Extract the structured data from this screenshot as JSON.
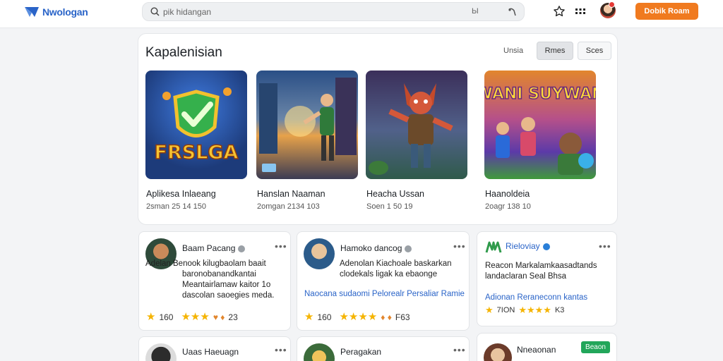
{
  "header": {
    "logo_text": "Nwologan",
    "search_placeholder": "pik hidangan",
    "search_badge": "Ы",
    "cta_label": "Dobik Roam",
    "notification_count": "4"
  },
  "featured": {
    "title": "Kapalenisian",
    "segment_label": "Unsia",
    "segment_a": "Rmes",
    "segment_b": "Sces",
    "games": [
      {
        "name": "Aplikesa Inlaeang",
        "meta": "2sman 25 14 150",
        "art_text": "FRSLGA",
        "colors": [
          "#1d3b7a",
          "#2d5fb5"
        ]
      },
      {
        "name": "Hanslan Naaman",
        "meta": "2omgan 2134 103",
        "art_text": "",
        "colors": [
          "#1c3f6e",
          "#e0913a"
        ]
      },
      {
        "name": "Heacha Ussan",
        "meta": "Soen 1 50 19",
        "art_text": "",
        "colors": [
          "#3b2f5a",
          "#a94b2c"
        ]
      },
      {
        "name": "Haanoldeia",
        "meta": "2oagr 138 10",
        "art_text": "WANI SUYWAN",
        "colors": [
          "#e2862d",
          "#5c3aa8"
        ]
      }
    ]
  },
  "posts": [
    {
      "author": "Baam Pacang",
      "body": "Adelan Benook kilugbaolam baait baronobanandkantai Meantairlamaw kaitor 1o dascolan saoegies meda.",
      "tags": "",
      "rating_count": "160",
      "rating_extra": "23",
      "avatar_colors": [
        "#c98a5a",
        "#2e4a3a"
      ]
    },
    {
      "author": "Hamoko dancog",
      "body": "Adenolan Kiachoale baskarkan clodekals ligak ka ebaonge",
      "tags": "Naocana sudaomi Pelorealr Persaliar Ramie",
      "rating_count": "160",
      "rating_extra": "F63",
      "avatar_colors": [
        "#e8c49b",
        "#2b5b8a"
      ]
    },
    {
      "author": "Rieloviay",
      "body": "Reacon Markalamkaasadtands landaclaran Seal Bhsa",
      "tags": "Adionan Reraneconn kantas",
      "rating_count": "7ION",
      "rating_extra": "K3",
      "avatar_colors": [
        "#2f9a4b",
        "#ffffff"
      ]
    },
    {
      "author": "Uaas Haeuagn",
      "avatar_colors": [
        "#2c2c2c",
        "#dcdcdc"
      ]
    },
    {
      "author": "Peragakan",
      "avatar_colors": [
        "#3b6b3a",
        "#f0c45b"
      ]
    },
    {
      "author": "Nneaonan",
      "follow_label": "Beaon",
      "avatar_colors": [
        "#6b3b2a",
        "#e8c4a0"
      ]
    }
  ],
  "colors": {
    "accent": "#f07a1f",
    "brand": "#2a64c8",
    "star": "#f5b400",
    "follow": "#22a65a"
  }
}
